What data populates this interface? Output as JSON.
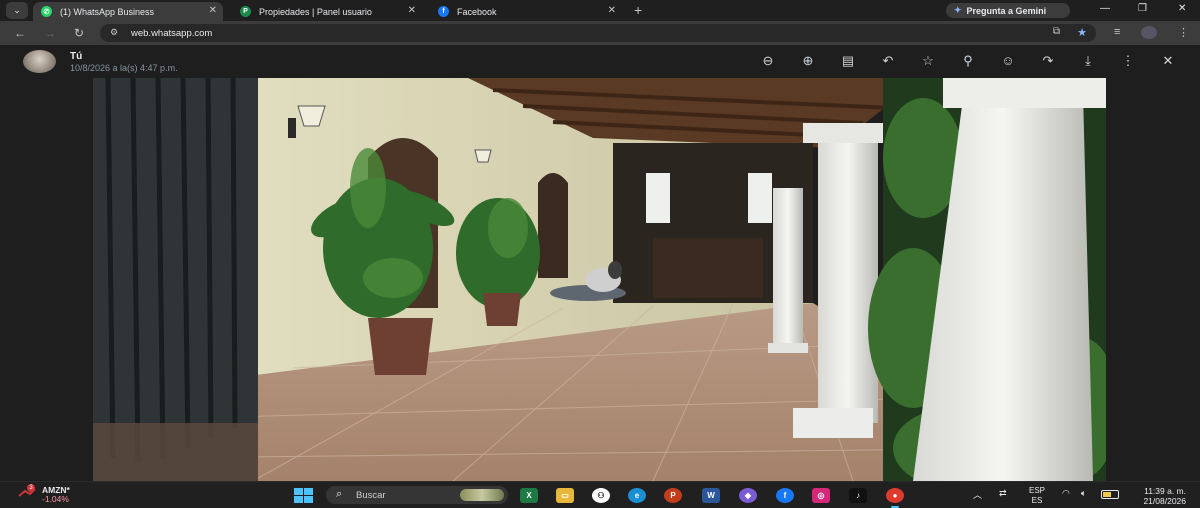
{
  "browser": {
    "tabs": [
      {
        "label": "(1) WhatsApp Business",
        "icon": "whatsapp-icon",
        "active": true
      },
      {
        "label": "Propiedades | Panel usuario",
        "icon": "site-icon",
        "active": false
      },
      {
        "label": "Facebook",
        "icon": "facebook-icon",
        "active": false
      }
    ],
    "gemini_label": "Pregunta a Gemini",
    "url": "web.whatsapp.com"
  },
  "viewer": {
    "sender": "Tú",
    "timestamp": "10/8/2026 a la(s) 4:47 p.m.",
    "toolbar_icons": [
      "zoom-out-icon",
      "zoom-in-icon",
      "caption-icon",
      "reply-icon",
      "star-icon",
      "pin-icon",
      "emoji-icon",
      "forward-icon",
      "download-icon",
      "more-icon",
      "close-icon"
    ]
  },
  "taskbar": {
    "stock_symbol": "AMZN*",
    "stock_change": "-1.04%",
    "stock_badge": "3",
    "search_placeholder": "Buscar",
    "lang_top": "ESP",
    "lang_bottom": "ES",
    "time": "11:39 a. m.",
    "date": "21/08/2026",
    "colors": {
      "accent": "#4cc2ff",
      "negative": "#ff99a4"
    }
  }
}
